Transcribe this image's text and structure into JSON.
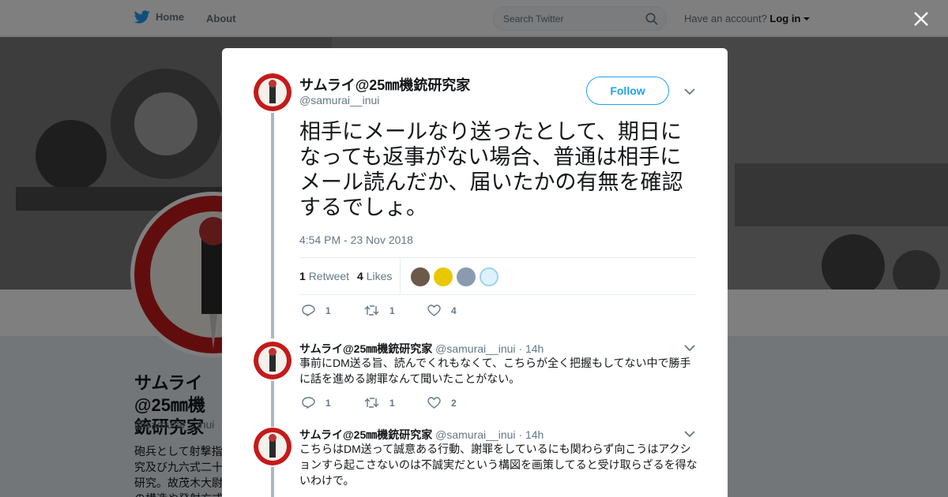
{
  "nav": {
    "home_label": "Home",
    "about_label": "About",
    "search_placeholder": "Search Twitter",
    "have_account": "Have an account?",
    "login_label": "Log in"
  },
  "profile": {
    "name": "サムライ@25㎜機銃研究家",
    "handle": "@samurai__inui",
    "bio": "砲兵として射撃指\n究及び九六式二十\n研究。故茂木大尉\nの構造や発射方式"
  },
  "tweet": {
    "author_name": "サムライ@25㎜機銃研究家",
    "author_handle": "@samurai__inui",
    "follow_label": "Follow",
    "text": "相手にメールなり送ったとして、期日になっても返事がない場合、普通は相手にメール読んだか、届いたかの有無を確認するでしょ。",
    "timestamp": "4:54 PM - 23 Nov 2018",
    "retweets_count": "1",
    "retweets_label": "Retweet",
    "likes_count": "4",
    "likes_label": "Likes",
    "reply_count": "1",
    "retweet_action_count": "1",
    "like_action_count": "4"
  },
  "replies": [
    {
      "name": "サムライ@25㎜機銃研究家",
      "handle": "@samurai__inui",
      "time": "· 14h",
      "text": "事前にDM送る旨、読んでくれもなくて、こちらが全く把握もしてない中で勝手に話を進める謝罪なんて聞いたことがない。",
      "reply_count": "1",
      "retweet_count": "1",
      "like_count": "2"
    },
    {
      "name": "サムライ@25㎜機銃研究家",
      "handle": "@samurai__inui",
      "time": "· 14h",
      "text": "こちらはDM送って誠意ある行動、謝罪をしているにも関わらず向こうはアクションすら起こさないのは不誠実だという構図を画策してると受け取らざるを得ないわけで。"
    }
  ],
  "colors": {
    "accent": "#1da1f2",
    "avatar_red": "#c41a1a",
    "secondary_text": "#657786"
  }
}
